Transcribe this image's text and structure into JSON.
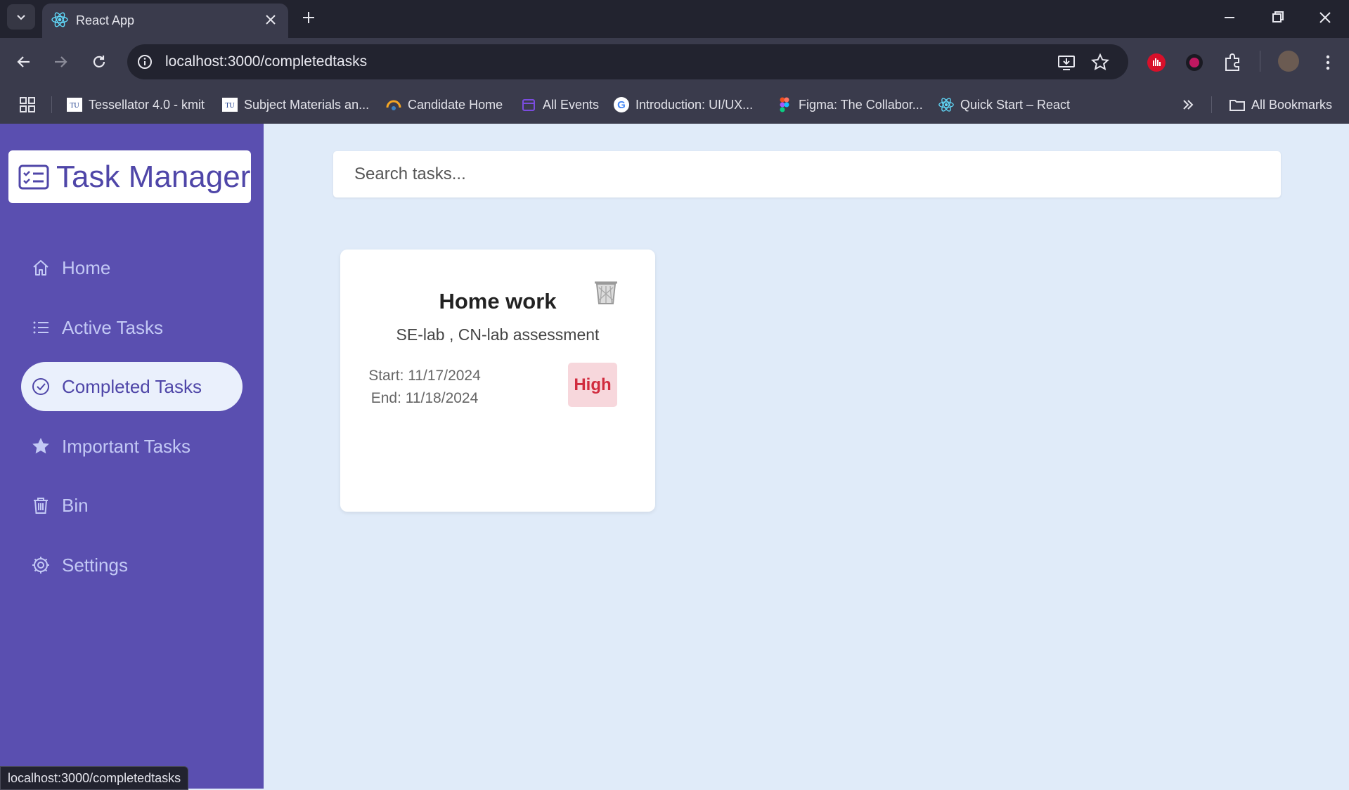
{
  "browser": {
    "tab_title": "React App",
    "url": "localhost:3000/completedtasks",
    "status_url": "localhost:3000/completedtasks",
    "bookmarks": [
      {
        "label": "Tessellator 4.0 - kmit",
        "icon": "tu-logo-icon"
      },
      {
        "label": "Subject Materials an...",
        "icon": "tu-logo-icon"
      },
      {
        "label": "Candidate Home",
        "icon": "candidate-home-icon"
      },
      {
        "label": "All Events",
        "icon": "events-icon"
      },
      {
        "label": "Introduction: UI/UX...",
        "icon": "google-icon"
      },
      {
        "label": "Figma: The Collabor...",
        "icon": "figma-icon"
      },
      {
        "label": "Quick Start – React",
        "icon": "react-icon"
      }
    ],
    "all_bookmarks_label": "All Bookmarks"
  },
  "app": {
    "logo_text": "Task Manager",
    "nav": [
      {
        "label": "Home",
        "icon": "home-icon",
        "active": false
      },
      {
        "label": "Active Tasks",
        "icon": "list-icon",
        "active": false
      },
      {
        "label": "Completed Tasks",
        "icon": "check-circle-icon",
        "active": true
      },
      {
        "label": "Important Tasks",
        "icon": "star-icon",
        "active": false
      },
      {
        "label": "Bin",
        "icon": "trash-icon",
        "active": false
      },
      {
        "label": "Settings",
        "icon": "gear-icon",
        "active": false
      }
    ],
    "search": {
      "placeholder": "Search tasks..."
    },
    "tasks": [
      {
        "title": "Home work",
        "description": "SE-lab , CN-lab assessment",
        "start": "Start: 11/17/2024",
        "end": "End: 11/18/2024",
        "priority": "High"
      }
    ]
  },
  "colors": {
    "sidebar": "#5a4fb0",
    "accent": "#4f46a8",
    "background": "#e0ebf9",
    "priority_high_bg": "#f7d7dc",
    "priority_high_text": "#d12c3f"
  }
}
